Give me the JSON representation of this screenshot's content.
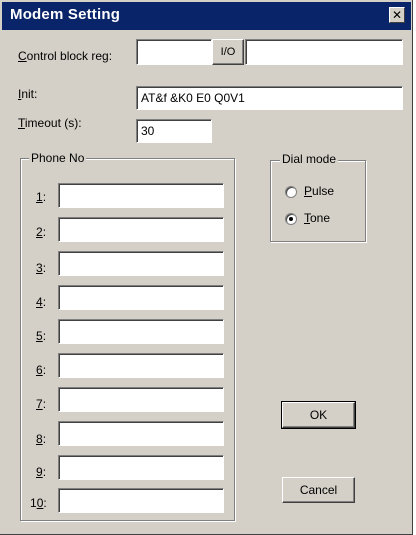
{
  "window": {
    "title": "Modem Setting",
    "close_glyph": "✕"
  },
  "control_block": {
    "label_prefix": "C",
    "label_rest": "ontrol block reg:",
    "left_value": "",
    "io_button": "I/O",
    "right_value": ""
  },
  "init": {
    "label_prefix": "I",
    "label_rest": "nit:",
    "value": "AT&f &K0 E0 Q0V1"
  },
  "timeout": {
    "label_prefix": "T",
    "label_rest": "imeout (s):",
    "value": "30"
  },
  "phone_group": {
    "title": "Phone No",
    "rows": [
      {
        "num": "1",
        "suffix": ":",
        "value": ""
      },
      {
        "num": "2",
        "suffix": ":",
        "value": ""
      },
      {
        "num": "3",
        "suffix": ":",
        "value": ""
      },
      {
        "num": "4",
        "suffix": ":",
        "value": ""
      },
      {
        "num": "5",
        "suffix": ":",
        "value": ""
      },
      {
        "num": "6",
        "suffix": ":",
        "value": ""
      },
      {
        "num": "7",
        "suffix": ":",
        "value": ""
      },
      {
        "num": "8",
        "suffix": ":",
        "value": ""
      },
      {
        "num": "9",
        "suffix": ":",
        "value": ""
      },
      {
        "num_prefix": "1",
        "num_under": "0",
        "suffix": ":",
        "value": ""
      }
    ]
  },
  "dial_mode": {
    "title": "Dial mode",
    "pulse": {
      "prefix": "P",
      "rest": "ulse",
      "selected": false
    },
    "tone": {
      "prefix": "T",
      "rest": "one",
      "selected": true
    }
  },
  "buttons": {
    "ok": "OK",
    "cancel": "Cancel"
  }
}
